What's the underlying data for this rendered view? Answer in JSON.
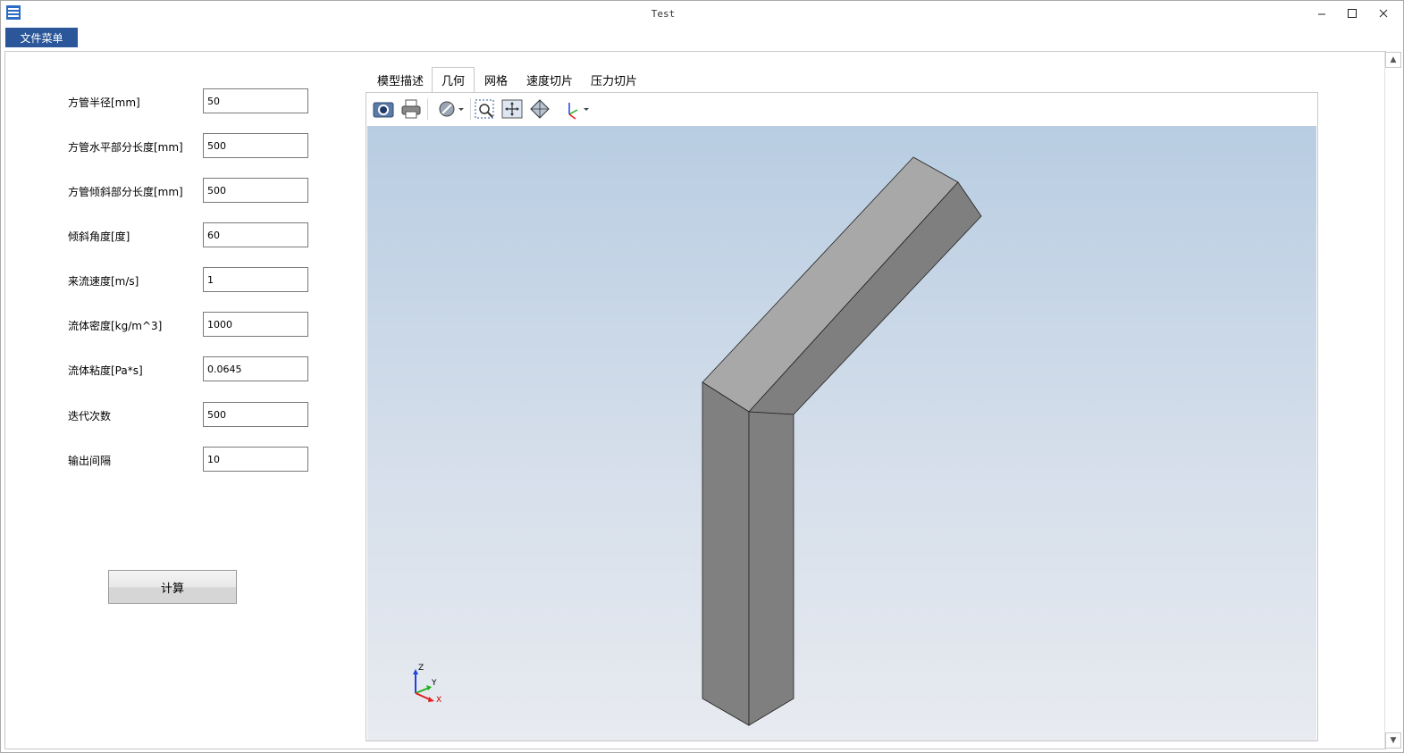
{
  "window": {
    "title": "Test",
    "min_icon": "minimize-icon",
    "max_icon": "maximize-icon",
    "close_icon": "close-icon"
  },
  "menu": {
    "file": "文件菜单"
  },
  "form": {
    "fields": [
      {
        "label": "方管半径[mm]",
        "value": "50"
      },
      {
        "label": "方管水平部分长度[mm]",
        "value": "500"
      },
      {
        "label": "方管倾斜部分长度[mm]",
        "value": "500"
      },
      {
        "label": "倾斜角度[度]",
        "value": "60"
      },
      {
        "label": "来流速度[m/s]",
        "value": "1"
      },
      {
        "label": "流体密度[kg/m^3]",
        "value": "1000"
      },
      {
        "label": "流体粘度[Pa*s]",
        "value": "0.0645"
      },
      {
        "label": "迭代次数",
        "value": "500"
      },
      {
        "label": "输出间隔",
        "value": "10"
      }
    ],
    "calc_button": "计算"
  },
  "tabs": [
    {
      "label": "模型描述",
      "active": false
    },
    {
      "label": "几何",
      "active": true
    },
    {
      "label": "网格",
      "active": false
    },
    {
      "label": "速度切片",
      "active": false
    },
    {
      "label": "压力切片",
      "active": false
    }
  ],
  "toolbar": {
    "icons": [
      "camera-icon",
      "print-icon",
      "display-mode-icon",
      "zoom-window-icon",
      "fit-all-icon",
      "axonometric-view-icon",
      "axis-view-icon"
    ]
  },
  "axes": {
    "z": "Z",
    "y": "Y",
    "x": "X"
  },
  "colors": {
    "accent": "#2b579a",
    "face_top": "#a8a8a8",
    "face_side": "#7f7f7f",
    "axis_x": "#e02020",
    "axis_y": "#20b020",
    "axis_z": "#2040e0"
  }
}
